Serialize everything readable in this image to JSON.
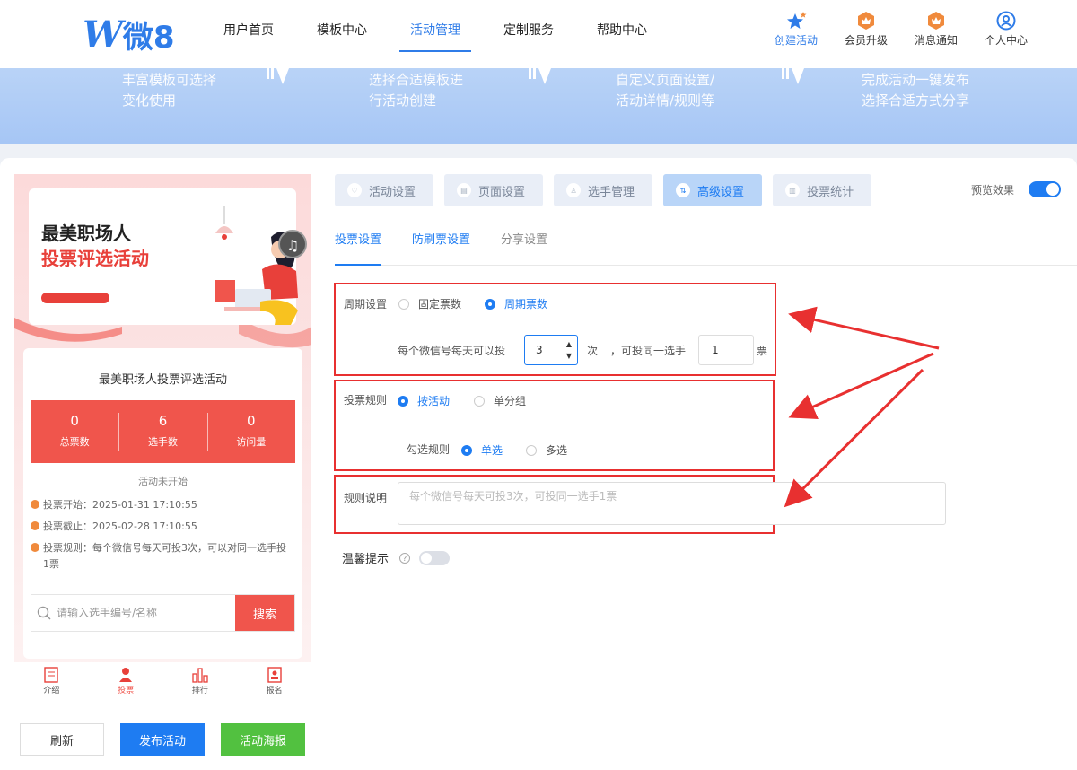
{
  "logo": {
    "w": "W",
    "text": "微8"
  },
  "nav": {
    "items": [
      "用户首页",
      "模板中心",
      "活动管理",
      "定制服务",
      "帮助中心"
    ],
    "right": [
      "创建活动",
      "会员升级",
      "消息通知",
      "个人中心"
    ]
  },
  "banner": {
    "steps": [
      [
        "丰富模板可选择",
        "变化使用"
      ],
      [
        "选择合适模板进",
        "行活动创建"
      ],
      [
        "自定义页面设置/",
        "活动详情/规则等"
      ],
      [
        "完成活动一键发布",
        "选择合适方式分享"
      ]
    ]
  },
  "phone": {
    "poster_title1": "最美职场人",
    "poster_title2": "投票评选活动",
    "activity_title": "最美职场人投票评选活动",
    "stats": [
      {
        "num": "0",
        "label": "总票数"
      },
      {
        "num": "6",
        "label": "选手数"
      },
      {
        "num": "0",
        "label": "访问量"
      }
    ],
    "status": "活动未开始",
    "vote_start": "投票开始：2025-01-31 17:10:55",
    "vote_end": "投票截止：2025-02-28 17:10:55",
    "vote_rule": "投票规则：每个微信号每天可投3次，可以对同一选手投1票",
    "search_placeholder": "请输入选手编号/名称",
    "search_btn": "搜索",
    "tabs": [
      "介绍",
      "投票",
      "排行",
      "报名"
    ]
  },
  "buttons": {
    "refresh": "刷新",
    "publish": "发布活动",
    "poster": "活动海报"
  },
  "settings": {
    "tabs": [
      "活动设置",
      "页面设置",
      "选手管理",
      "高级设置",
      "投票统计"
    ],
    "preview": "预览效果",
    "sub_tabs": [
      "投票设置",
      "防刷票设置",
      "分享设置"
    ],
    "period_label": "周期设置",
    "period_fixed": "固定票数",
    "period_cycle": "周期票数",
    "per_day_label": "每个微信号每天可以投",
    "per_day_value": "3",
    "times_unit": "次",
    "same_player_label": "，可投同一选手",
    "same_player_value": "1",
    "votes_unit": "票",
    "rule_label": "投票规则",
    "rule_by_activity": "按活动",
    "rule_by_group": "单分组",
    "select_label": "勾选规则",
    "select_single": "单选",
    "select_multi": "多选",
    "desc_label": "规则说明",
    "desc_placeholder": "每个微信号每天可投3次，可投同一选手1票",
    "warm_tip": "温馨提示",
    "qmark": "?"
  }
}
